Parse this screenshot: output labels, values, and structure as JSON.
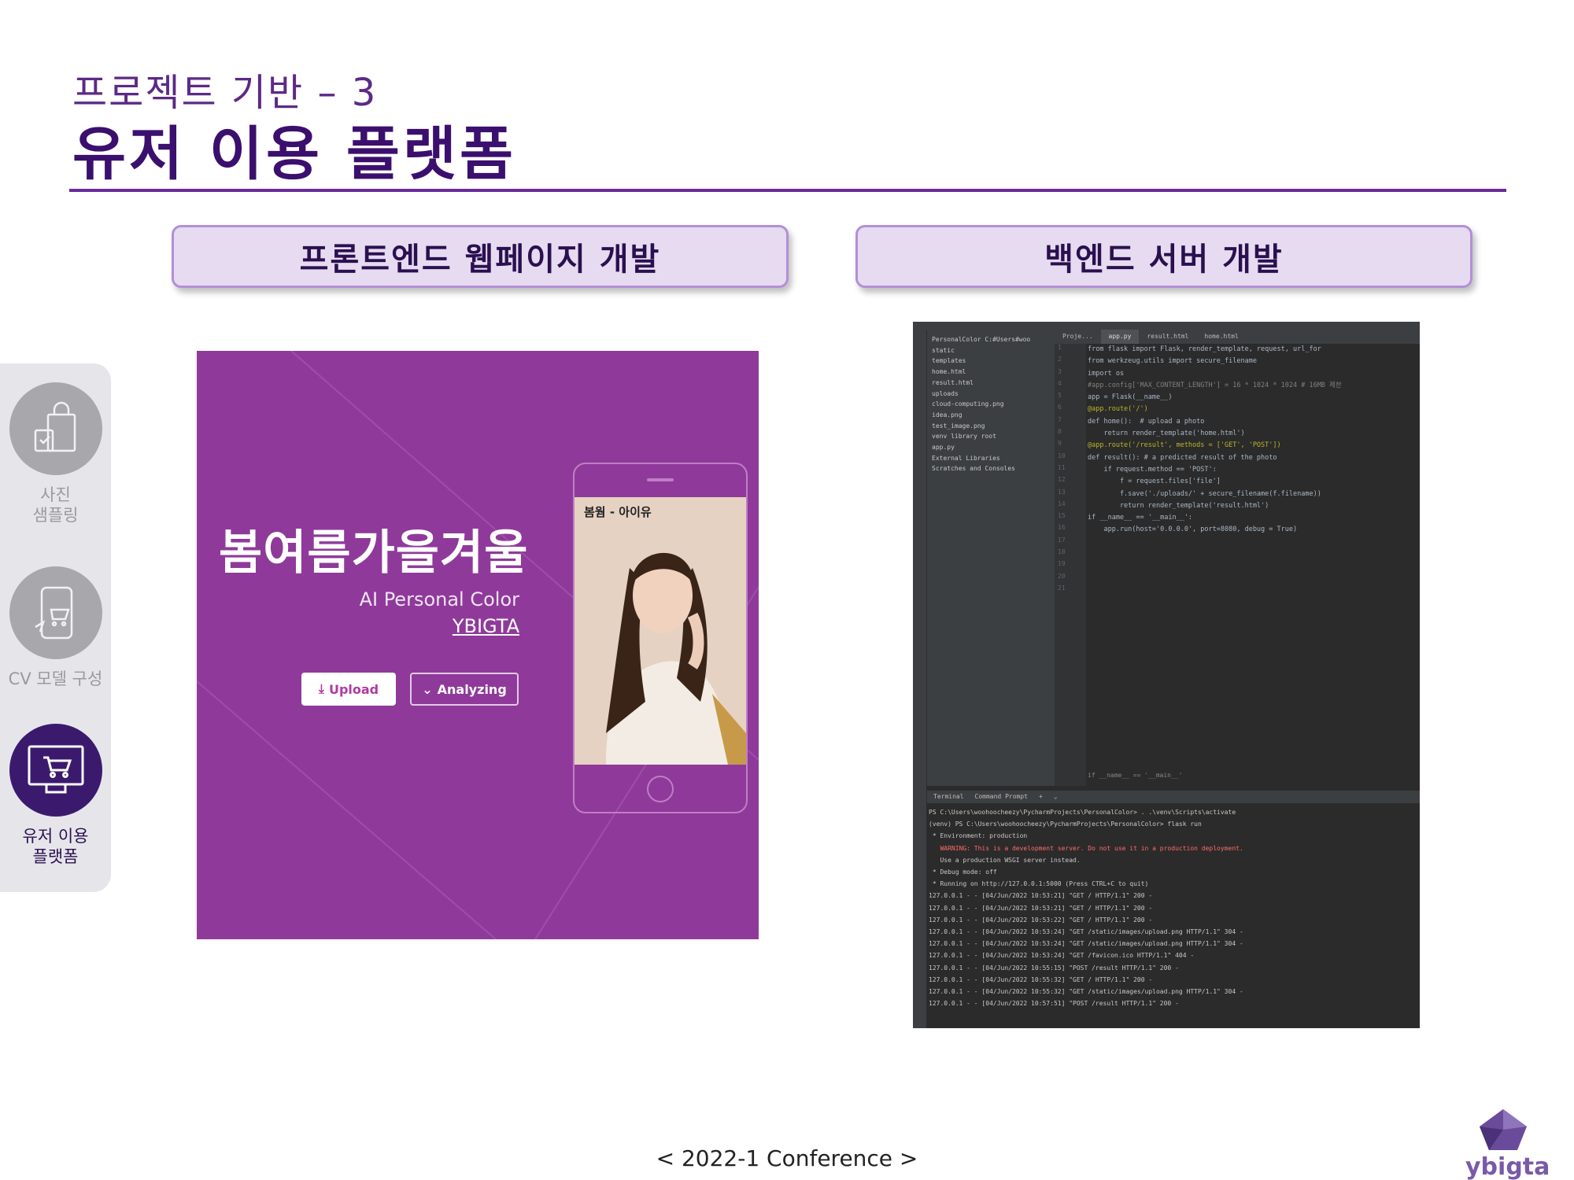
{
  "slide": {
    "subtitle": "프로젝트 기반 – 3",
    "title": "유저 이용 플랫폼",
    "footer": "< 2022-1 Conference >",
    "logo_text": "ybigta"
  },
  "sections": {
    "frontend_title": "프론트엔드 웹페이지 개발",
    "backend_title": "백엔드 서버 개발"
  },
  "sidenav": {
    "items": [
      {
        "label_line1": "사진",
        "label_line2": "샘플링",
        "icon": "shopping-bags-icon",
        "active": false
      },
      {
        "label_line1": "CV 모델 구성",
        "label_line2": "",
        "icon": "phone-cart-icon",
        "active": false
      },
      {
        "label_line1": "유저 이용",
        "label_line2": "플랫폼",
        "icon": "monitor-cart-icon",
        "active": true
      }
    ]
  },
  "frontend_mock": {
    "hero_title": "봄여름가을겨울",
    "subtitle": "AI Personal Color",
    "brand": "YBIGTA",
    "upload_label": "Upload",
    "analyzing_label": "Analyzing",
    "phone_caption": "봄웜 - 아이유"
  },
  "ide": {
    "tabs": [
      "Proje...",
      "app.py",
      "result.html",
      "home.html"
    ],
    "tree": [
      "PersonalColor C:#Users#woo",
      "  static",
      "  templates",
      "    home.html",
      "    result.html",
      "  uploads",
      "    cloud-computing.png",
      "    idea.png",
      "    test_image.png",
      "  venv library root",
      "  app.py",
      "External Libraries",
      "Scratches and Consoles"
    ],
    "line_numbers": [
      "1",
      "2",
      "3",
      "4",
      "5",
      "6",
      "7",
      "8",
      "9",
      "10",
      "11",
      "12",
      "13",
      "14",
      "15",
      "16",
      "17",
      "18",
      "19",
      "20",
      "21"
    ],
    "code_lines": [
      "from flask import Flask, render_template, request, url_for",
      "from werkzeug.utils import secure_filename",
      "import os",
      "",
      "#app.config['MAX_CONTENT_LENGTH'] = 16 * 1024 * 1024 # 16MB 제한",
      "",
      "app = Flask(__name__)",
      "",
      "@app.route('/')",
      "def home():  # upload a photo",
      "    return render_template('home.html')",
      "",
      "@app.route('/result', methods = ['GET', 'POST'])",
      "def result(): # a predicted result of the photo",
      "    if request.method == 'POST':",
      "        f = request.files['file']",
      "        f.save('./uploads/' + secure_filename(f.filename))",
      "        return render_template('result.html')",
      "",
      "if __name__ == '__main__':",
      "    app.run(host='0.0.0.0', port=8080, debug = True)"
    ],
    "breadcrumb": "if __name__ == '__main__'",
    "terminal_tabs": [
      "Terminal",
      "Command Prompt"
    ],
    "terminal_lines": [
      "PS C:\\Users\\woohoocheezy\\PycharmProjects\\PersonalColor> . .\\venv\\Scripts\\activate",
      "(venv) PS C:\\Users\\woohoocheezy\\PycharmProjects\\PersonalColor> flask run",
      " * Environment: production",
      "   WARNING: This is a development server. Do not use it in a production deployment.",
      "   Use a production WSGI server instead.",
      " * Debug mode: off",
      " * Running on http://127.0.0.1:5000 (Press CTRL+C to quit)",
      "127.0.0.1 - - [04/Jun/2022 10:53:21] \"GET / HTTP/1.1\" 200 -",
      "127.0.0.1 - - [04/Jun/2022 10:53:21] \"GET / HTTP/1.1\" 200 -",
      "127.0.0.1 - - [04/Jun/2022 10:53:22] \"GET / HTTP/1.1\" 200 -",
      "127.0.0.1 - - [04/Jun/2022 10:53:24] \"GET /static/images/upload.png HTTP/1.1\" 304 -",
      "127.0.0.1 - - [04/Jun/2022 10:53:24] \"GET /static/images/upload.png HTTP/1.1\" 304 -",
      "127.0.0.1 - - [04/Jun/2022 10:53:24] \"GET /favicon.ico HTTP/1.1\" 404 -",
      "127.0.0.1 - - [04/Jun/2022 10:55:15] \"POST /result HTTP/1.1\" 200 -",
      "127.0.0.1 - - [04/Jun/2022 10:55:32] \"GET / HTTP/1.1\" 200 -",
      "127.0.0.1 - - [04/Jun/2022 10:55:32] \"GET /static/images/upload.png HTTP/1.1\" 304 -",
      "127.0.0.1 - - [04/Jun/2022 10:57:51] \"POST /result HTTP/1.1\" 200 -"
    ]
  },
  "colors": {
    "accent": "#5b2a86",
    "title": "#3b0f6e",
    "front_bg": "#8f3a9a",
    "header_fill": "#e6dbf0",
    "header_border": "#b38fd8"
  }
}
